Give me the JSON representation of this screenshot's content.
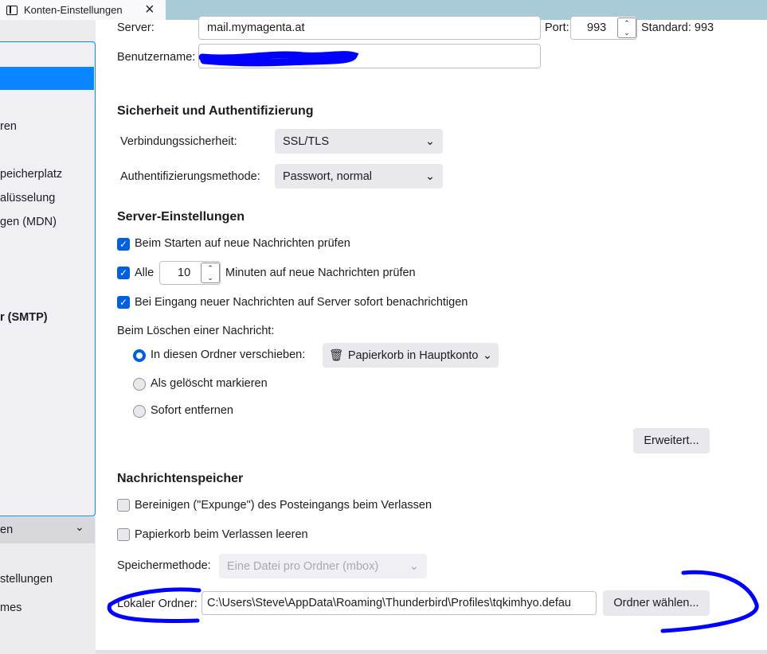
{
  "tab": {
    "title": "Konten-Einstellungen",
    "icon": "sidebar-icon",
    "close": "×"
  },
  "sidebar": {
    "items": [
      "ren",
      "peicherplatz",
      "alüsselung",
      "gen (MDN)",
      "r (SMTP)"
    ],
    "dropdown": "en",
    "links": [
      "stellungen",
      "mes"
    ]
  },
  "server": {
    "label": "Server:",
    "value": "mail.mymagenta.at",
    "port_label": "Port:",
    "port": "993",
    "standard": "Standard: 993"
  },
  "username": {
    "label": "Benutzername:",
    "value": ""
  },
  "security": {
    "heading": "Sicherheit und Authentifizierung",
    "conn_label": "Verbindungssicherheit:",
    "conn_value": "SSL/TLS",
    "auth_label": "Authentifizierungsmethode:",
    "auth_value": "Passwort, normal"
  },
  "server_settings": {
    "heading": "Server-Einstellungen",
    "check_startup": "Beim Starten auf neue Nachrichten prüfen",
    "check_every": "Alle",
    "minutes": "10",
    "minutes_label": "Minuten auf neue Nachrichten prüfen",
    "notify": "Bei Eingang neuer Nachrichten auf Server sofort benachrichtigen",
    "delete_label": "Beim Löschen einer Nachricht:",
    "move_to": "In diesen Ordner verschieben:",
    "folder": "Papierkorb in Hauptkonto",
    "mark_deleted": "Als gelöscht markieren",
    "remove_now": "Sofort entfernen",
    "advanced": "Erweitert..."
  },
  "storage": {
    "heading": "Nachrichtenspeicher",
    "expunge": "Bereinigen (\"Expunge\") des Posteingangs beim Verlassen",
    "empty_trash": "Papierkorb beim Verlassen leeren",
    "method_label": "Speichermethode:",
    "method_value": "Eine Datei pro Ordner (mbox)",
    "local_label": "Lokaler Ordner:",
    "local_value": "C:\\Users\\Steve\\AppData\\Roaming\\Thunderbird\\Profiles\\tqkimhyo.defau",
    "choose": "Ordner wählen..."
  },
  "colors": {
    "accent": "#0061e0",
    "annotation": "#0000ff"
  }
}
